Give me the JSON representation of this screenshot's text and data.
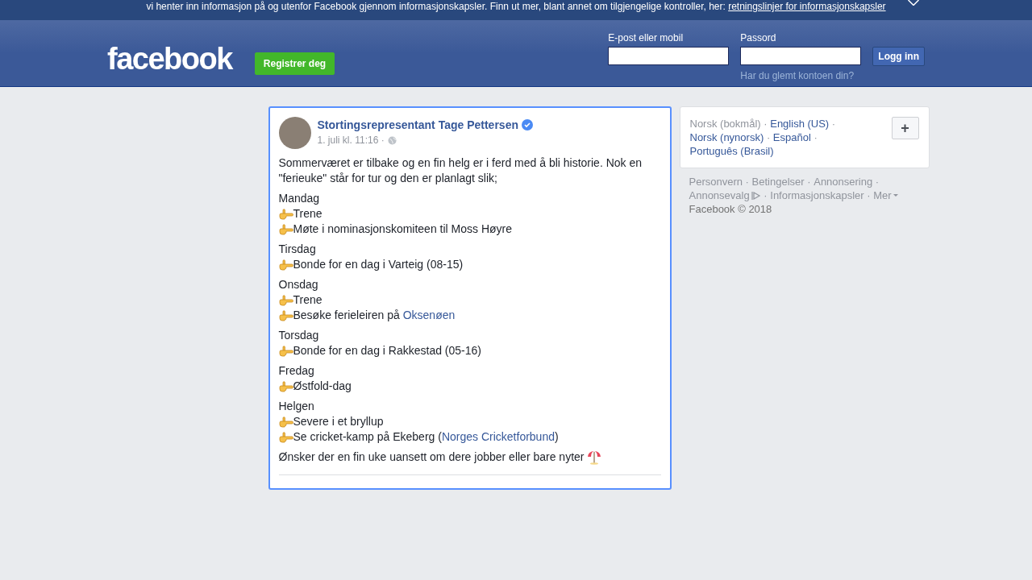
{
  "cookie_banner": {
    "text": "vi henter inn informasjon på og utenfor Facebook gjennom informasjonskapsler. Finn ut mer, blant annet om tilgjengelige kontroller, her:",
    "link": "retningslinjer for informasjonskapsler"
  },
  "header": {
    "logo": "facebook",
    "register_button": "Registrer deg",
    "email_label": "E-post eller mobil",
    "password_label": "Passord",
    "login_button": "Logg inn",
    "forgot_link": "Har du glemt kontoen din?"
  },
  "post": {
    "author": "Stortingsrepresentant Tage Pettersen",
    "verified": true,
    "time": "1. juli kl. 11:16 ·",
    "intro": "Sommerværet er tilbake og en fin helg er i ferd med å bli historie. Nok en \"ferieuke\" står for tur og den er planlagt slik;",
    "days": [
      {
        "day": "Mandag",
        "items": [
          [
            {
              "kind": "text",
              "text": "Trene"
            }
          ],
          [
            {
              "kind": "text",
              "text": "Møte i nominasjonskomiteen til Moss Høyre"
            }
          ]
        ]
      },
      {
        "day": "Tirsdag",
        "items": [
          [
            {
              "kind": "text",
              "text": "Bonde for en dag i Varteig (08-15)"
            }
          ]
        ]
      },
      {
        "day": "Onsdag",
        "items": [
          [
            {
              "kind": "text",
              "text": "Trene"
            }
          ],
          [
            {
              "kind": "text",
              "text": "Besøke ferieleiren på "
            },
            {
              "kind": "link",
              "text": "Oksenøen"
            }
          ]
        ]
      },
      {
        "day": "Torsdag",
        "items": [
          [
            {
              "kind": "text",
              "text": "Bonde for en dag i Rakkestad (05-16)"
            }
          ]
        ]
      },
      {
        "day": "Fredag",
        "items": [
          [
            {
              "kind": "text",
              "text": "Østfold-dag"
            }
          ]
        ]
      },
      {
        "day": "Helgen",
        "items": [
          [
            {
              "kind": "text",
              "text": "Severe i et bryllup"
            }
          ],
          [
            {
              "kind": "text",
              "text": "Se cricket-kamp på Ekeberg ("
            },
            {
              "kind": "link",
              "text": "Norges Cricketforbund"
            },
            {
              "kind": "text",
              "text": ")"
            }
          ]
        ]
      }
    ],
    "closing": "Ønsker der en fin uke uansett om dere jobber eller bare nyter"
  },
  "languages": [
    {
      "label": "Norsk (bokmål)",
      "selected": true
    },
    {
      "label": "English (US)",
      "selected": false
    },
    {
      "label": "Norsk (nynorsk)",
      "selected": false
    },
    {
      "label": "Español",
      "selected": false
    },
    {
      "label": "Português (Brasil)",
      "selected": false
    }
  ],
  "language_separator": "·",
  "add_language_button": "+",
  "footer_separator": "·",
  "footer_links": [
    {
      "label": "Personvern",
      "kind": "plain"
    },
    {
      "label": "Betingelser",
      "kind": "plain"
    },
    {
      "label": "Annonsering",
      "kind": "plain"
    },
    {
      "label": "Annonsevalg",
      "kind": "adchoices"
    },
    {
      "label": "Informasjonskapsler",
      "kind": "plain"
    },
    {
      "label": "Mer",
      "kind": "more"
    }
  ],
  "copyright": "Facebook © 2018"
}
